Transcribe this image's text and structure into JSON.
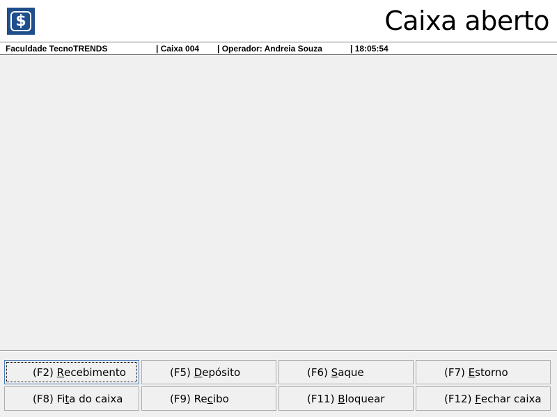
{
  "header": {
    "logo_glyph": "$",
    "title": "Caixa aberto"
  },
  "status": {
    "institution": "Faculdade TecnoTRENDS",
    "caixa": "| Caixa 004",
    "operator": "| Operador: Andreia Souza",
    "time": "| 18:05:54"
  },
  "buttons": [
    {
      "key": "(F2)",
      "pre": "",
      "mnemonic": "R",
      "post": "ecebimento"
    },
    {
      "key": "(F5)",
      "pre": "",
      "mnemonic": "D",
      "post": "epósito"
    },
    {
      "key": "(F6)",
      "pre": "",
      "mnemonic": "S",
      "post": "aque"
    },
    {
      "key": "(F7)",
      "pre": "",
      "mnemonic": "E",
      "post": "storno"
    },
    {
      "key": "(F8)",
      "pre": "Fi",
      "mnemonic": "t",
      "post": "a do caixa"
    },
    {
      "key": "(F9)",
      "pre": "Re",
      "mnemonic": "c",
      "post": "ibo"
    },
    {
      "key": "(F11)",
      "pre": "",
      "mnemonic": "B",
      "post": "loquear"
    },
    {
      "key": "(F12)",
      "pre": "",
      "mnemonic": "F",
      "post": "echar caixa"
    }
  ],
  "colors": {
    "logo_bg": "#1f4e8c",
    "window_bg": "#f0f0f0",
    "focus_border": "#4a78b8"
  },
  "icons": {
    "logo": "dollar-sign-icon"
  }
}
